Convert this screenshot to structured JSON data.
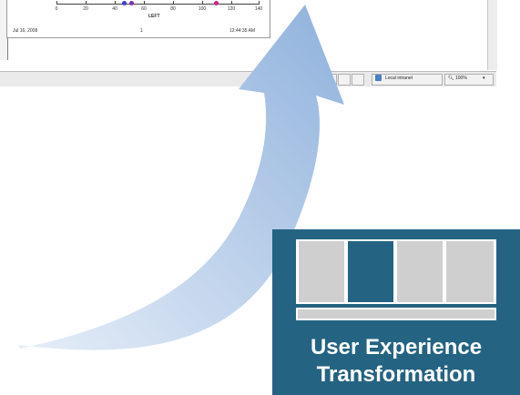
{
  "screenshot": {
    "axis": {
      "ticks": [
        "0",
        "20",
        "40",
        "60",
        "80",
        "100",
        "120",
        "140"
      ],
      "title": "LEFT"
    },
    "footer": {
      "date": "Jul 16, 2008",
      "page": "1",
      "time": "12:44:35 AM"
    },
    "status_bar": {
      "zone": "Local intranet",
      "zoom": "100%"
    }
  },
  "badge": {
    "line1": "User Experience",
    "line2": "Transformation",
    "colors": {
      "background": "#246382",
      "highlight": "#246382",
      "column": "#cfcfcf"
    }
  },
  "colors": {
    "arrow_start": "#e6eef8",
    "arrow_end": "#8fb1dc",
    "dot_blue": "#4040d0",
    "dot_purple": "#8030b0",
    "dot_magenta": "#d0208a"
  }
}
